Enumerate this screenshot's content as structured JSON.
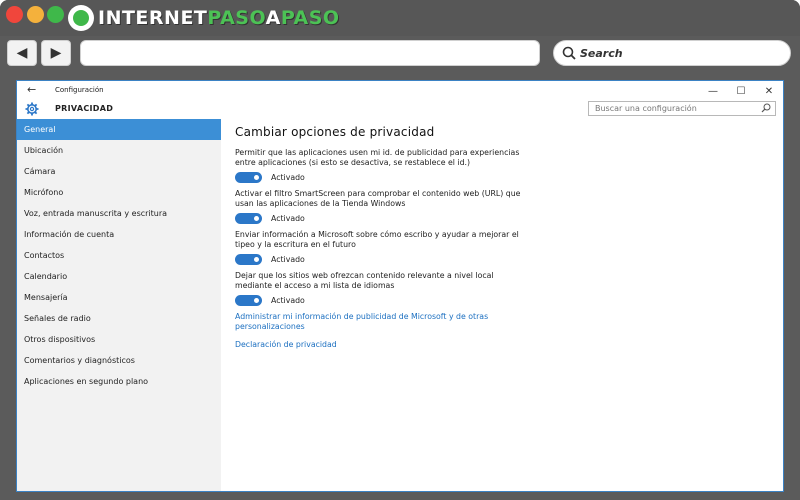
{
  "browser": {
    "logo": {
      "part1": "INTERNET",
      "part2": "PASO",
      "part3": "A",
      "part4": "PASO"
    },
    "nav": {
      "back_icon": "◀",
      "forward_icon": "▶"
    },
    "address_value": "",
    "search_label": "Search",
    "colors": {
      "close": "#f0463c",
      "minimize": "#f4b13c",
      "maximize": "#3fb84a",
      "brand_green": "#4cc255"
    }
  },
  "window": {
    "back_icon": "←",
    "title": "Configuración",
    "controls": {
      "minimize": "—",
      "maximize": "☐",
      "close": "✕"
    },
    "header_title": "PRIVACIDAD",
    "search_placeholder": "Buscar una configuración"
  },
  "sidebar": {
    "items": [
      {
        "label": "General",
        "active": true
      },
      {
        "label": "Ubicación"
      },
      {
        "label": "Cámara"
      },
      {
        "label": "Micrófono"
      },
      {
        "label": "Voz, entrada manuscrita y escritura"
      },
      {
        "label": "Información de cuenta"
      },
      {
        "label": "Contactos"
      },
      {
        "label": "Calendario"
      },
      {
        "label": "Mensajería"
      },
      {
        "label": "Señales de radio"
      },
      {
        "label": "Otros dispositivos"
      },
      {
        "label": "Comentarios y diagnósticos"
      },
      {
        "label": "Aplicaciones en segundo plano"
      }
    ],
    "accent_color": "#3c8fd6"
  },
  "main": {
    "heading": "Cambiar opciones de privacidad",
    "options": [
      {
        "text": "Permitir que las aplicaciones usen mi id. de publicidad para experiencias entre aplicaciones (si esto se desactiva, se restablece el id.)",
        "state": "Activado",
        "on": true
      },
      {
        "text": "Activar el filtro SmartScreen para comprobar el contenido web (URL) que usan las aplicaciones de la Tienda Windows",
        "state": "Activado",
        "on": true
      },
      {
        "text": "Enviar información a Microsoft sobre cómo escribo y ayudar a mejorar el tipeo y la escritura en el futuro",
        "state": "Activado",
        "on": true
      },
      {
        "text": "Dejar que los sitios web ofrezcan contenido relevante a nivel local mediante el acceso a mi lista de idiomas",
        "state": "Activado",
        "on": true
      }
    ],
    "links": [
      "Administrar mi información de publicidad de Microsoft y de otras personalizaciones",
      "Declaración de privacidad"
    ],
    "toggle_color": "#2b77c8",
    "link_color": "#1b6fc0"
  }
}
